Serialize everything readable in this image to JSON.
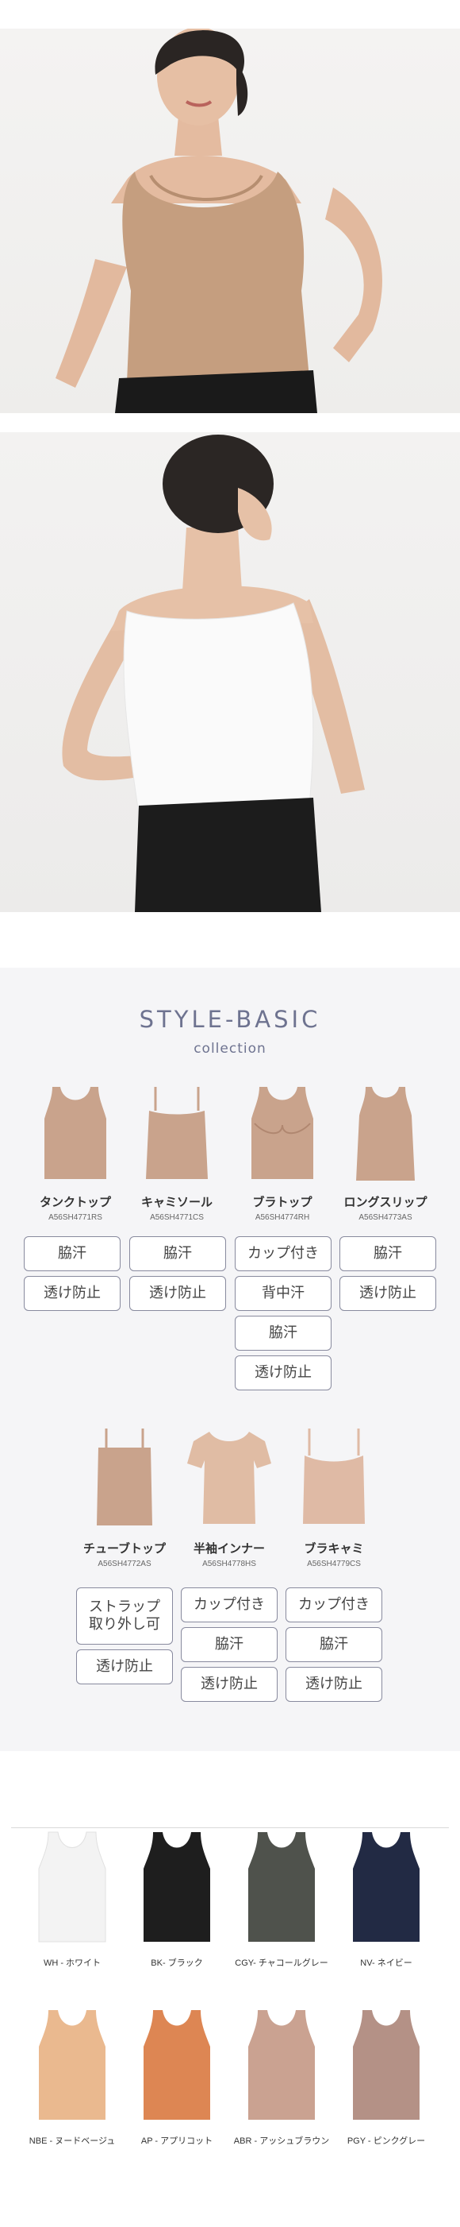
{
  "collection": {
    "title": "STYLE-BASIC",
    "subtitle": "collection",
    "items": [
      {
        "name": "タンクトップ",
        "code": "A56SH4771RS",
        "tags": [
          "脇汗",
          "透け防止"
        ]
      },
      {
        "name": "キャミソール",
        "code": "A56SH4771CS",
        "tags": [
          "脇汗",
          "透け防止"
        ]
      },
      {
        "name": "ブラトップ",
        "code": "A56SH4774RH",
        "tags": [
          "カップ付き",
          "背中汗",
          "脇汗",
          "透け防止"
        ]
      },
      {
        "name": "ロングスリップ",
        "code": "A56SH4773AS",
        "tags": [
          "脇汗",
          "透け防止"
        ]
      },
      {
        "name": "チューブトップ",
        "code": "A56SH4772AS",
        "tags": [
          "ストラップ\n取り外し可",
          "透け防止"
        ]
      },
      {
        "name": "半袖インナー",
        "code": "A56SH4778HS",
        "tags": [
          "カップ付き",
          "脇汗",
          "透け防止"
        ]
      },
      {
        "name": "ブラキャミ",
        "code": "A56SH4779CS",
        "tags": [
          "カップ付き",
          "脇汗",
          "透け防止"
        ]
      }
    ]
  },
  "colors": [
    {
      "label": "WH - ホワイト",
      "hex": "#f3f3f3"
    },
    {
      "label": "BK- ブラック",
      "hex": "#1e1e1e"
    },
    {
      "label": "CGY- チャコールグレー",
      "hex": "#4f524c"
    },
    {
      "label": "NV- ネイビー",
      "hex": "#222a44"
    },
    {
      "label": "NBE - ヌードベージュ",
      "hex": "#eab98f"
    },
    {
      "label": "AP - アプリコット",
      "hex": "#dd8653"
    },
    {
      "label": "ABR - アッシュブラウン",
      "hex": "#caa291"
    },
    {
      "label": "PGY - ピンクグレー",
      "hex": "#b49186"
    }
  ],
  "theme": {
    "accent": "#6e7390",
    "product_color": "#c9a38c"
  }
}
